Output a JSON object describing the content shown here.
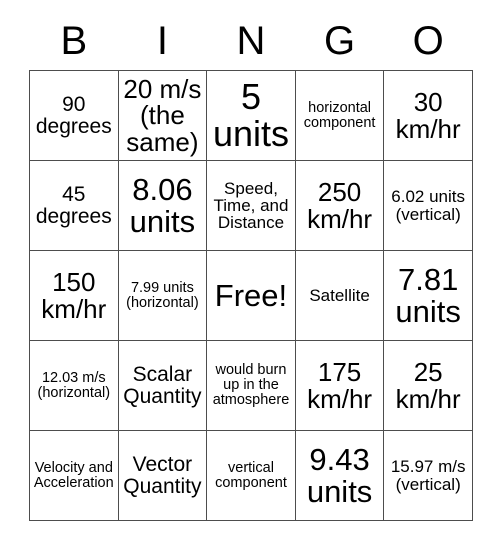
{
  "card": {
    "headers": [
      "B",
      "I",
      "N",
      "G",
      "O"
    ],
    "rows": [
      [
        {
          "text": "90 degrees",
          "size": "fs-m"
        },
        {
          "text": "20 m/s (the same)",
          "size": "fs-l"
        },
        {
          "text": "5 units",
          "size": "fs-xxl"
        },
        {
          "text": "horizontal component",
          "size": "fs-xs"
        },
        {
          "text": "30 km/hr",
          "size": "fs-l"
        }
      ],
      [
        {
          "text": "45 degrees",
          "size": "fs-m"
        },
        {
          "text": "8.06 units",
          "size": "fs-xl"
        },
        {
          "text": "Speed, Time, and Distance",
          "size": "fs-s"
        },
        {
          "text": "250 km/hr",
          "size": "fs-l"
        },
        {
          "text": "6.02 units (vertical)",
          "size": "fs-s"
        }
      ],
      [
        {
          "text": "150 km/hr",
          "size": "fs-l"
        },
        {
          "text": "7.99 units (horizontal)",
          "size": "fs-xs"
        },
        {
          "text": "Free!",
          "size": "fs-xl"
        },
        {
          "text": "Satellite",
          "size": "fs-s"
        },
        {
          "text": "7.81 units",
          "size": "fs-xl"
        }
      ],
      [
        {
          "text": "12.03 m/s (horizontal)",
          "size": "fs-xs"
        },
        {
          "text": "Scalar Quantity",
          "size": "fs-m"
        },
        {
          "text": "would burn up in the atmosphere",
          "size": "fs-xs"
        },
        {
          "text": "175 km/hr",
          "size": "fs-l"
        },
        {
          "text": "25 km/hr",
          "size": "fs-l"
        }
      ],
      [
        {
          "text": "Velocity and Acceleration",
          "size": "fs-xs"
        },
        {
          "text": "Vector Quantity",
          "size": "fs-m"
        },
        {
          "text": "vertical component",
          "size": "fs-xs"
        },
        {
          "text": "9.43 units",
          "size": "fs-xl"
        },
        {
          "text": "15.97 m/s (vertical)",
          "size": "fs-s"
        }
      ]
    ]
  }
}
